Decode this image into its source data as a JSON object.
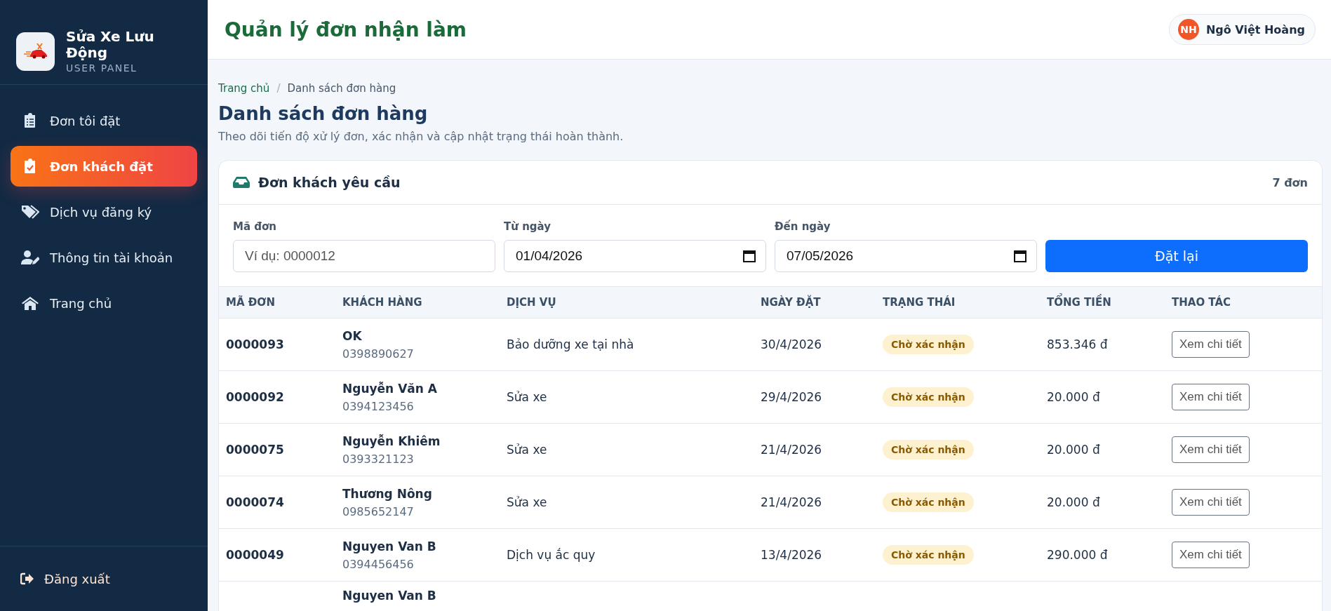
{
  "sidebar": {
    "brand": {
      "title": "Sửa Xe Lưu Động",
      "subtitle": "USER PANEL"
    },
    "items": [
      {
        "label": "Đơn tôi đặt",
        "selected": false
      },
      {
        "label": "Đơn khách đặt",
        "selected": true
      },
      {
        "label": "Dịch vụ đăng ký",
        "selected": false
      },
      {
        "label": "Thông tin tài khoản",
        "selected": false
      },
      {
        "label": "Trang chủ",
        "selected": false
      }
    ],
    "logout": "Đăng xuất"
  },
  "header": {
    "title": "Quản lý đơn nhận làm",
    "user": {
      "initials": "NH",
      "name": "Ngô Việt Hoàng"
    }
  },
  "breadcrumb_separator": "/",
  "breadcrumb": [
    {
      "label": "Trang chủ",
      "kind": "link"
    },
    {
      "label": "Danh sách đơn hàng",
      "kind": "current"
    }
  ],
  "page": {
    "title": "Danh sách đơn hàng",
    "subtitle": "Theo dõi tiến độ xử lý đơn, xác nhận và cập nhật trạng thái hoàn thành."
  },
  "card": {
    "title": "Đơn khách yêu cầu",
    "count": "7 đơn",
    "filters": [
      {
        "label": "Mã đơn",
        "placeholder": "Ví dụ: 0000012",
        "kind": "text"
      },
      {
        "label": "Từ ngày",
        "value": "01/04/2026",
        "kind": "date"
      },
      {
        "label": "Đến ngày",
        "value": "07/05/2026",
        "kind": "date"
      }
    ],
    "reset_button": "Đặt lại",
    "table": {
      "columns": [
        "MÃ ĐƠN",
        "KHÁCH HÀNG",
        "DỊCH VỤ",
        "NGÀY ĐẶT",
        "TRẠNG THÁI",
        "TỔNG TIỀN",
        "THAO TÁC"
      ],
      "rows": [
        {
          "id": "0000093",
          "name": "OK",
          "phone": "0398890627",
          "service": "Bảo dưỡng xe tại nhà",
          "date": "30/4/2026",
          "status": {
            "label": "Chờ xác nhận",
            "kind": "pending"
          },
          "total": "853.346 đ",
          "action": "Xem chi tiết"
        },
        {
          "id": "0000092",
          "name": "Nguyễn Văn A",
          "phone": "0394123456",
          "service": "Sửa xe",
          "date": "29/4/2026",
          "status": {
            "label": "Chờ xác nhận",
            "kind": "pending"
          },
          "total": "20.000 đ",
          "action": "Xem chi tiết"
        },
        {
          "id": "0000075",
          "name": "Nguyễn Khiêm",
          "phone": "0393321123",
          "service": "Sửa xe",
          "date": "21/4/2026",
          "status": {
            "label": "Chờ xác nhận",
            "kind": "pending"
          },
          "total": "20.000 đ",
          "action": "Xem chi tiết"
        },
        {
          "id": "0000074",
          "name": "Thương Nông",
          "phone": "0985652147",
          "service": "Sửa xe",
          "date": "21/4/2026",
          "status": {
            "label": "Chờ xác nhận",
            "kind": "pending"
          },
          "total": "20.000 đ",
          "action": "Xem chi tiết"
        },
        {
          "id": "0000049",
          "name": "Nguyen Van B",
          "phone": "0394456456",
          "service": "Dịch vụ ắc quy",
          "date": "13/4/2026",
          "status": {
            "label": "Chờ xác nhận",
            "kind": "pending"
          },
          "total": "290.000 đ",
          "action": "Xem chi tiết"
        },
        {
          "name": "Nguyen Van B"
        }
      ]
    }
  }
}
